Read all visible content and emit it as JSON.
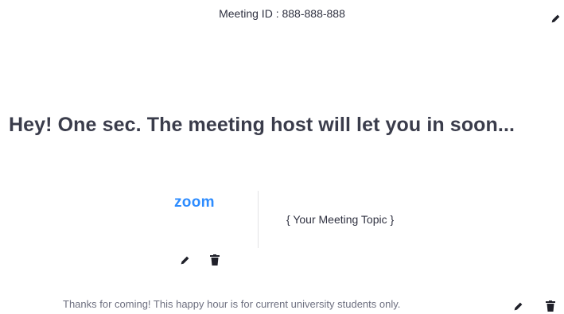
{
  "header": {
    "meeting_id": "Meeting ID : 888-888-888"
  },
  "main": {
    "headline": "Hey! One sec. The meeting host will let you in soon...",
    "logo_text": "zoom",
    "topic": "{ Your Meeting Topic }",
    "footer_text": "Thanks for coming! This happy hour is for current university students only."
  },
  "icons": {
    "edit": "pencil-icon",
    "delete": "trash-icon"
  },
  "colors": {
    "brand": "#2d8cff",
    "text": "#3a3c4b",
    "muted": "#6e7080"
  }
}
